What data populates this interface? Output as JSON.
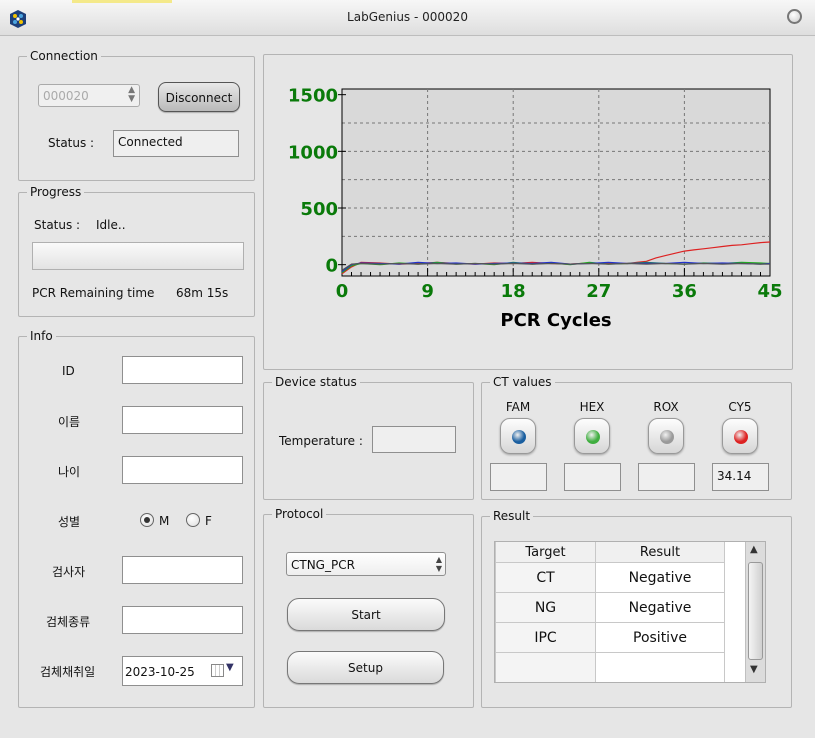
{
  "window": {
    "title": "LabGenius - 000020"
  },
  "connection": {
    "title": "Connection",
    "port_value": "000020",
    "disconnect_label": "Disconnect",
    "status_label": "Status :",
    "status_value": "Connected"
  },
  "progress": {
    "title": "Progress",
    "status_label": "Status :",
    "status_value": "Idle..",
    "progress_fraction": 0,
    "remaining_label": "PCR Remaining time",
    "remaining_value": "68m 15s"
  },
  "info": {
    "title": "Info",
    "id_label": "ID",
    "name_label": "이름",
    "age_label": "나이",
    "sex_label": "성별",
    "sex_m_label": "M",
    "sex_f_label": "F",
    "sex_selected": "M",
    "examiner_label": "검사자",
    "specimen_label": "검체종류",
    "date_label": "검체채취일",
    "date_value": "2023-10-25",
    "id_value": "",
    "name_value": "",
    "age_value": "",
    "examiner_value": "",
    "specimen_value": ""
  },
  "chart_data": {
    "type": "line",
    "xlabel": "PCR Cycles",
    "xlim": [
      0,
      45
    ],
    "ylim": [
      -100,
      1550
    ],
    "xticks": [
      0,
      9,
      18,
      27,
      36,
      45
    ],
    "yticks": [
      0,
      500,
      1000,
      1500
    ],
    "grid": true,
    "series": [
      {
        "color": "#dd2222",
        "points": [
          [
            0,
            -80
          ],
          [
            1,
            -20
          ],
          [
            2,
            20
          ],
          [
            4,
            15
          ],
          [
            6,
            5
          ],
          [
            8,
            10
          ],
          [
            10,
            20
          ],
          [
            12,
            10
          ],
          [
            14,
            5
          ],
          [
            16,
            15
          ],
          [
            18,
            10
          ],
          [
            20,
            20
          ],
          [
            22,
            10
          ],
          [
            24,
            5
          ],
          [
            26,
            15
          ],
          [
            28,
            10
          ],
          [
            30,
            10
          ],
          [
            31,
            20
          ],
          [
            32,
            30
          ],
          [
            33,
            60
          ],
          [
            34,
            80
          ],
          [
            35,
            100
          ],
          [
            36,
            120
          ],
          [
            37,
            130
          ],
          [
            38,
            140
          ],
          [
            39,
            150
          ],
          [
            40,
            160
          ],
          [
            41,
            170
          ],
          [
            42,
            175
          ],
          [
            43,
            185
          ],
          [
            44,
            195
          ],
          [
            45,
            200
          ]
        ]
      },
      {
        "color": "#22aa22",
        "points": [
          [
            0,
            -70
          ],
          [
            1,
            -10
          ],
          [
            2,
            10
          ],
          [
            4,
            0
          ],
          [
            6,
            15
          ],
          [
            8,
            5
          ],
          [
            10,
            20
          ],
          [
            12,
            5
          ],
          [
            14,
            10
          ],
          [
            16,
            0
          ],
          [
            18,
            20
          ],
          [
            20,
            5
          ],
          [
            22,
            15
          ],
          [
            24,
            0
          ],
          [
            26,
            20
          ],
          [
            28,
            5
          ],
          [
            30,
            10
          ],
          [
            32,
            20
          ],
          [
            34,
            10
          ],
          [
            36,
            5
          ],
          [
            38,
            15
          ],
          [
            40,
            10
          ],
          [
            42,
            20
          ],
          [
            44,
            15
          ],
          [
            45,
            10
          ]
        ]
      },
      {
        "color": "#2233cc",
        "points": [
          [
            0,
            -60
          ],
          [
            1,
            0
          ],
          [
            2,
            15
          ],
          [
            4,
            10
          ],
          [
            6,
            5
          ],
          [
            8,
            20
          ],
          [
            10,
            10
          ],
          [
            12,
            15
          ],
          [
            14,
            5
          ],
          [
            16,
            10
          ],
          [
            18,
            15
          ],
          [
            20,
            10
          ],
          [
            22,
            20
          ],
          [
            24,
            5
          ],
          [
            26,
            10
          ],
          [
            28,
            20
          ],
          [
            30,
            10
          ],
          [
            32,
            15
          ],
          [
            34,
            10
          ],
          [
            36,
            20
          ],
          [
            38,
            10
          ],
          [
            40,
            15
          ],
          [
            42,
            10
          ],
          [
            44,
            5
          ],
          [
            45,
            10
          ]
        ]
      },
      {
        "color": "#555555",
        "points": [
          [
            0,
            -50
          ],
          [
            1,
            5
          ],
          [
            2,
            10
          ],
          [
            4,
            5
          ],
          [
            6,
            10
          ],
          [
            8,
            5
          ],
          [
            10,
            10
          ],
          [
            12,
            5
          ],
          [
            14,
            10
          ],
          [
            16,
            5
          ],
          [
            18,
            10
          ],
          [
            20,
            5
          ],
          [
            22,
            10
          ],
          [
            24,
            5
          ],
          [
            26,
            10
          ],
          [
            28,
            5
          ],
          [
            30,
            10
          ],
          [
            32,
            5
          ],
          [
            34,
            10
          ],
          [
            36,
            5
          ],
          [
            38,
            10
          ],
          [
            40,
            5
          ],
          [
            42,
            10
          ],
          [
            44,
            5
          ],
          [
            45,
            5
          ]
        ]
      }
    ]
  },
  "device_status": {
    "title": "Device status",
    "temperature_label": "Temperature :",
    "temperature_value": ""
  },
  "ct_values": {
    "title": "CT values",
    "channels": [
      {
        "name": "FAM",
        "color": "#1a5fa0",
        "value": ""
      },
      {
        "name": "HEX",
        "color": "#3fae3f",
        "value": ""
      },
      {
        "name": "ROX",
        "color": "#9a9a9a",
        "value": ""
      },
      {
        "name": "CY5",
        "color": "#dd2222",
        "value": "34.14"
      }
    ]
  },
  "protocol": {
    "title": "Protocol",
    "selected": "CTNG_PCR",
    "start_label": "Start",
    "setup_label": "Setup"
  },
  "result": {
    "title": "Result",
    "headers": [
      "Target",
      "Result"
    ],
    "rows": [
      [
        "CT",
        "Negative"
      ],
      [
        "NG",
        "Negative"
      ],
      [
        "IPC",
        "Positive"
      ],
      [
        "",
        ""
      ]
    ]
  }
}
